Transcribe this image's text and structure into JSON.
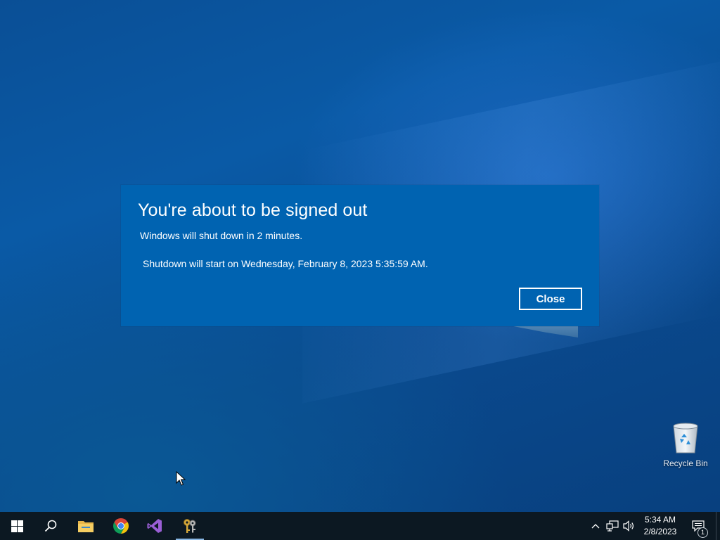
{
  "dialog": {
    "title": "You're about to be signed out",
    "message": "Windows will shut down in 2 minutes.",
    "detail": "Shutdown will start on Wednesday, February 8, 2023 5:35:59 AM.",
    "close_label": "Close",
    "background_color": "#0063b1"
  },
  "desktop": {
    "icons": [
      {
        "label": "Recycle Bin",
        "icon": "recycle-bin-icon"
      }
    ]
  },
  "taskbar": {
    "pinned": [
      {
        "name": "start",
        "icon": "windows-logo-icon"
      },
      {
        "name": "search",
        "icon": "search-icon"
      },
      {
        "name": "file-explorer",
        "icon": "folder-icon"
      },
      {
        "name": "chrome",
        "icon": "chrome-icon"
      },
      {
        "name": "visual-studio",
        "icon": "visual-studio-icon"
      },
      {
        "name": "keys-app",
        "icon": "keys-icon",
        "active": true
      }
    ],
    "tray": {
      "time": "5:34 AM",
      "date": "2/8/2023",
      "notification_count": "1"
    },
    "background_color": "#0c1822"
  }
}
